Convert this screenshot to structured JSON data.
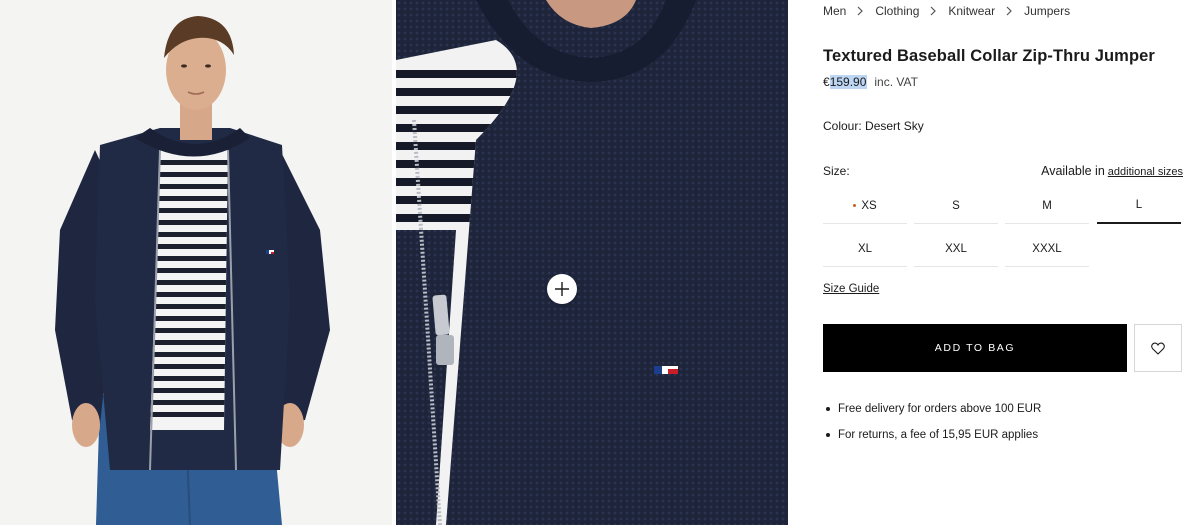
{
  "breadcrumb": {
    "items": [
      "Men",
      "Clothing",
      "Knitwear",
      "Jumpers"
    ]
  },
  "product": {
    "title": "Textured Baseball Collar Zip-Thru Jumper",
    "currency": "€",
    "price": "159.90",
    "vat_note": "inc. VAT",
    "colour_label": "Colour:",
    "colour_value": "Desert Sky"
  },
  "size": {
    "label": "Size:",
    "availability_text": "Available in",
    "availability_link": "additional sizes",
    "options": [
      {
        "label": "XS",
        "low_stock": true
      },
      {
        "label": "S",
        "low_stock": false
      },
      {
        "label": "M",
        "low_stock": false
      },
      {
        "label": "L",
        "low_stock": false
      },
      {
        "label": "XL",
        "low_stock": false
      },
      {
        "label": "XXL",
        "low_stock": false
      },
      {
        "label": "XXXL",
        "low_stock": false
      }
    ],
    "selected": "L",
    "guide_label": "Size Guide"
  },
  "actions": {
    "add_to_bag": "ADD TO BAG",
    "wishlist_icon": "heart-icon"
  },
  "info": [
    "Free delivery for orders above 100 EUR",
    "For returns, a fee of 15,95 EUR applies"
  ],
  "gallery": {
    "images": [
      "model-front-photo",
      "fabric-detail-photo"
    ],
    "zoom_icon": "plus-icon"
  },
  "colors": {
    "button_bg": "#000000",
    "button_text": "#ffffff",
    "price_highlight": "#bcd6f4",
    "low_stock_dot": "#c9621f",
    "garment_navy": "#1d2438"
  }
}
